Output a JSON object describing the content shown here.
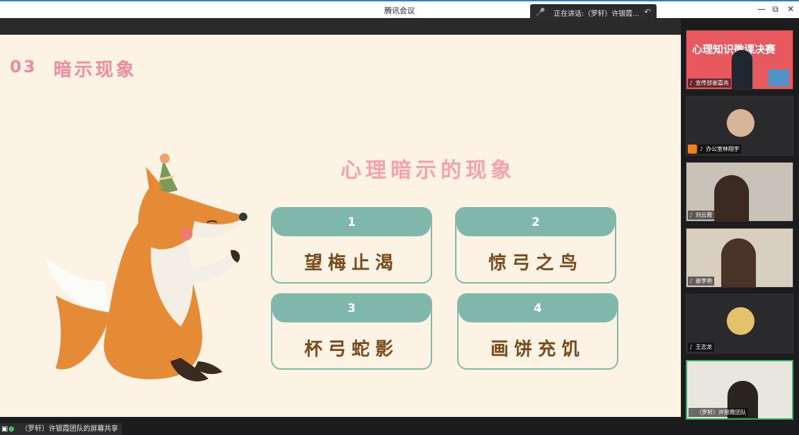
{
  "window": {
    "title": "腾讯会议",
    "controls": {
      "minimize": "—",
      "restore": "⧉",
      "close": "✕"
    }
  },
  "speaking": {
    "label": "正在讲话:（罗轩）许银霞..."
  },
  "slide": {
    "section_number": "03",
    "section_title": "暗示现象",
    "heading": "心理暗示的现象",
    "cards": [
      {
        "number": "1",
        "text": "望梅止渴"
      },
      {
        "number": "2",
        "text": "惊弓之鸟"
      },
      {
        "number": "3",
        "text": "杯弓蛇影"
      },
      {
        "number": "4",
        "text": "画饼充饥"
      }
    ]
  },
  "share_label": "（罗轩）许银霞团队的屏幕共享",
  "participants": [
    {
      "name": "宣传部谢嘉亮",
      "video_text": "心理知识微课决赛"
    },
    {
      "name": "办公室林翔宇"
    },
    {
      "name": "刘云霞"
    },
    {
      "name": "谢李艳"
    },
    {
      "name": "王志龙"
    },
    {
      "name": "（罗轩）许银霞团队"
    }
  ],
  "colors": {
    "accent_blue": "#2f7bd9",
    "slide_bg": "#fdf3e4",
    "teal": "#7fb7aa",
    "pink": "#f08aa0",
    "active_green": "#2fb35b"
  },
  "icons": [
    "mic-icon",
    "screen-share-icon",
    "camera-off-icon",
    "collapse-arrow-icon"
  ]
}
